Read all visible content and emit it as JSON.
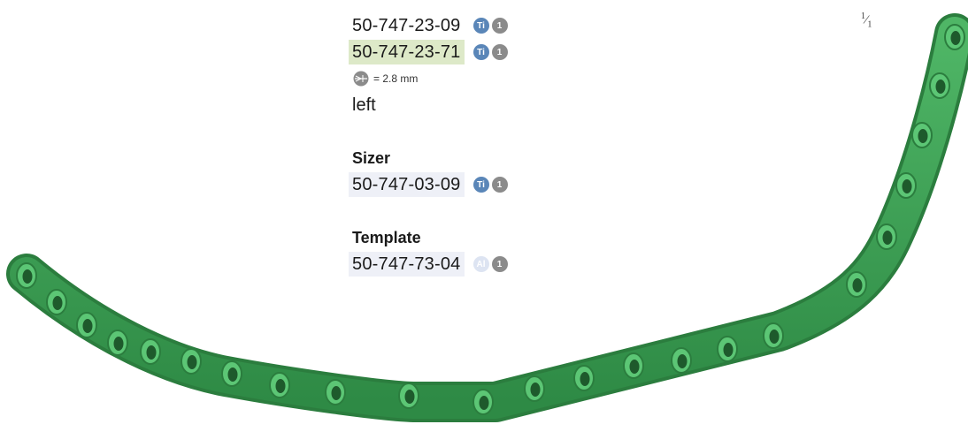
{
  "plate_codes": [
    {
      "code": "50-747-23-09",
      "material": "Ti",
      "quantity": "1"
    },
    {
      "code": "50-747-23-71",
      "material": "Ti",
      "quantity": "1"
    }
  ],
  "drill_note": "= 2.8 mm",
  "side": "left",
  "sizer": {
    "heading": "Sizer",
    "code": "50-747-03-09",
    "material": "Ti",
    "quantity": "1"
  },
  "template": {
    "heading": "Template",
    "code": "50-747-73-04",
    "material": "Al",
    "quantity": "1"
  },
  "scale": {
    "numerator": "1",
    "denominator": "1"
  },
  "colors": {
    "plate_green": "#3f9f55",
    "highlight_green": "#dde9c8",
    "highlight_lavender": "#eef0f7",
    "ti_badge": "#5a86b8",
    "al_badge": "#dde4f2",
    "qty_badge": "#8b8b8b"
  },
  "icons": {
    "drill": "drill-diameter-icon"
  }
}
